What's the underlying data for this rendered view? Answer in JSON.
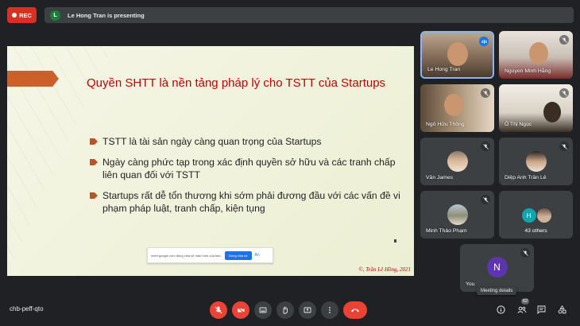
{
  "topbar": {
    "rec_label": "REC",
    "presenter_initial": "L",
    "presenting_text": "Le Hong Tran is presenting"
  },
  "slide": {
    "title": "Quyền SHTT là nền tảng pháp lý cho TSTT của Startups",
    "bullets": [
      "TSTT là tài sản ngày càng quan trọng của Startups",
      "Ngày càng phức tạp trong xác định quyền sở hữu và các tranh chấp liên quan đối với TSTT",
      "Startups rất dễ tổn thương khi sớm phải đương đầu với các vấn đề vi phạm pháp luật, tranh chấp, kiện tụng"
    ],
    "share_bar_text": "meet.google.com đang chia sẻ màn hình của bạn.",
    "share_stop_label": "Dừng chia sẻ",
    "share_hide_label": "Ẩn",
    "copyright": "©, Trần Lê Hồng, 2021"
  },
  "participants": [
    {
      "name": "Le Hong Tran",
      "mic": "on"
    },
    {
      "name": "Nguyen Minh Hằng",
      "mic": "off"
    },
    {
      "name": "Ngô Hữu Thông",
      "mic": "off"
    },
    {
      "name": "Ô Thị Ngọc",
      "mic": "off"
    },
    {
      "name": "Văn James",
      "mic": "off"
    },
    {
      "name": "Diệp Anh Trần Lê",
      "mic": "off"
    },
    {
      "name": "Minh Thảo Phạm",
      "mic": "off"
    }
  ],
  "others": {
    "initial": "H",
    "label": "43 others"
  },
  "self": {
    "initial": "N",
    "label": "You"
  },
  "tooltip": "Meeting details",
  "bottombar": {
    "meeting_code": "chb-peff-qto",
    "people_count": "62"
  },
  "colors": {
    "background": "#202124",
    "rec": "#d93025",
    "slide_title": "#c00000",
    "end_call": "#ea4335",
    "active_mic": "#1a73e8"
  }
}
